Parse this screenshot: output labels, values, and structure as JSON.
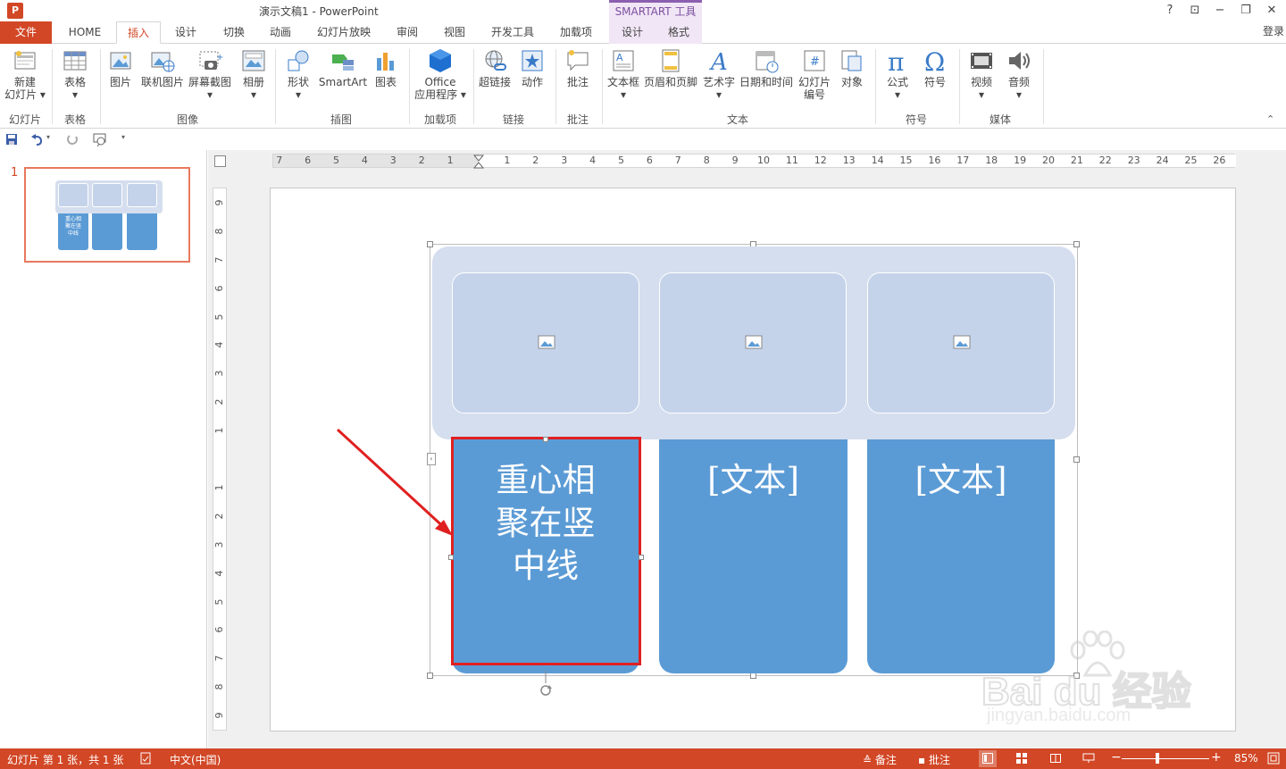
{
  "window": {
    "title": "演示文稿1 - PowerPoint",
    "context_tab_group": "SMARTART 工具",
    "help": "?",
    "ribbon_display": "⊡",
    "minimize": "−",
    "restore": "❐",
    "close": "✕",
    "login": "登录"
  },
  "tabs": {
    "file": "文件",
    "home": "HOME",
    "insert": "插入",
    "design": "设计",
    "transitions": "切换",
    "animations": "动画",
    "slideshow": "幻灯片放映",
    "review": "审阅",
    "view": "视图",
    "developer": "开发工具",
    "addins": "加载项",
    "sa_design": "设计",
    "sa_format": "格式"
  },
  "ribbon": {
    "new_slide": "新建",
    "new_slide2": "幻灯片",
    "table": "表格",
    "picture": "图片",
    "online_picture": "联机图片",
    "screenshot": "屏幕截图",
    "album": "相册",
    "shapes": "形状",
    "smartart": "SmartArt",
    "chart": "图表",
    "office_apps": "Office",
    "office_apps2": "应用程序",
    "hyperlink": "超链接",
    "action": "动作",
    "comment": "批注",
    "textbox": "文本框",
    "header_footer": "页眉和页脚",
    "wordart": "艺术字",
    "datetime": "日期和时间",
    "slide_number": "幻灯片",
    "slide_number2": "编号",
    "object": "对象",
    "equation": "公式",
    "symbol": "符号",
    "video": "视频",
    "audio": "音频",
    "groups": {
      "slides": "幻灯片",
      "tables": "表格",
      "images": "图像",
      "illustrations": "插图",
      "addins": "加载项",
      "links": "链接",
      "comments": "批注",
      "text": "文本",
      "symbols": "符号",
      "media": "媒体"
    }
  },
  "slide_panel": {
    "slide_number": "1",
    "thumb_text": "重心相聚在竖中线"
  },
  "smartart": {
    "boxes": [
      {
        "text": "重心相聚在竖中线"
      },
      {
        "text": "[文本]"
      },
      {
        "text": "[文本]"
      }
    ]
  },
  "ruler": {
    "h_left": [
      "7",
      "6",
      "5",
      "4",
      "3",
      "2",
      "1"
    ],
    "h_right": [
      "1",
      "2",
      "3",
      "4",
      "5",
      "6",
      "7",
      "8",
      "9",
      "10",
      "11",
      "12",
      "13",
      "14",
      "15",
      "16",
      "17",
      "18",
      "19",
      "20",
      "21",
      "22",
      "23",
      "24",
      "25",
      "26"
    ],
    "v_top": [
      "9",
      "8",
      "7",
      "6",
      "5",
      "4",
      "3",
      "2",
      "1"
    ],
    "v_bottom": [
      "1",
      "2",
      "3",
      "4",
      "5",
      "6",
      "7",
      "8",
      "9"
    ]
  },
  "statusbar": {
    "slide_info": "幻灯片 第 1 张，共 1 张",
    "language": "中文(中国)",
    "notes": "备注",
    "comments": "批注",
    "zoom": "85%"
  },
  "watermark": {
    "brand": "Bai du 经验",
    "url": "jingyan.baidu.com"
  },
  "colors": {
    "accent": "#d24726",
    "smartart_light": "#c5d3ea",
    "smartart_bg": "#d5deee",
    "smartart_dark": "#5b9bd5",
    "context_purple": "#8b5fb0"
  }
}
